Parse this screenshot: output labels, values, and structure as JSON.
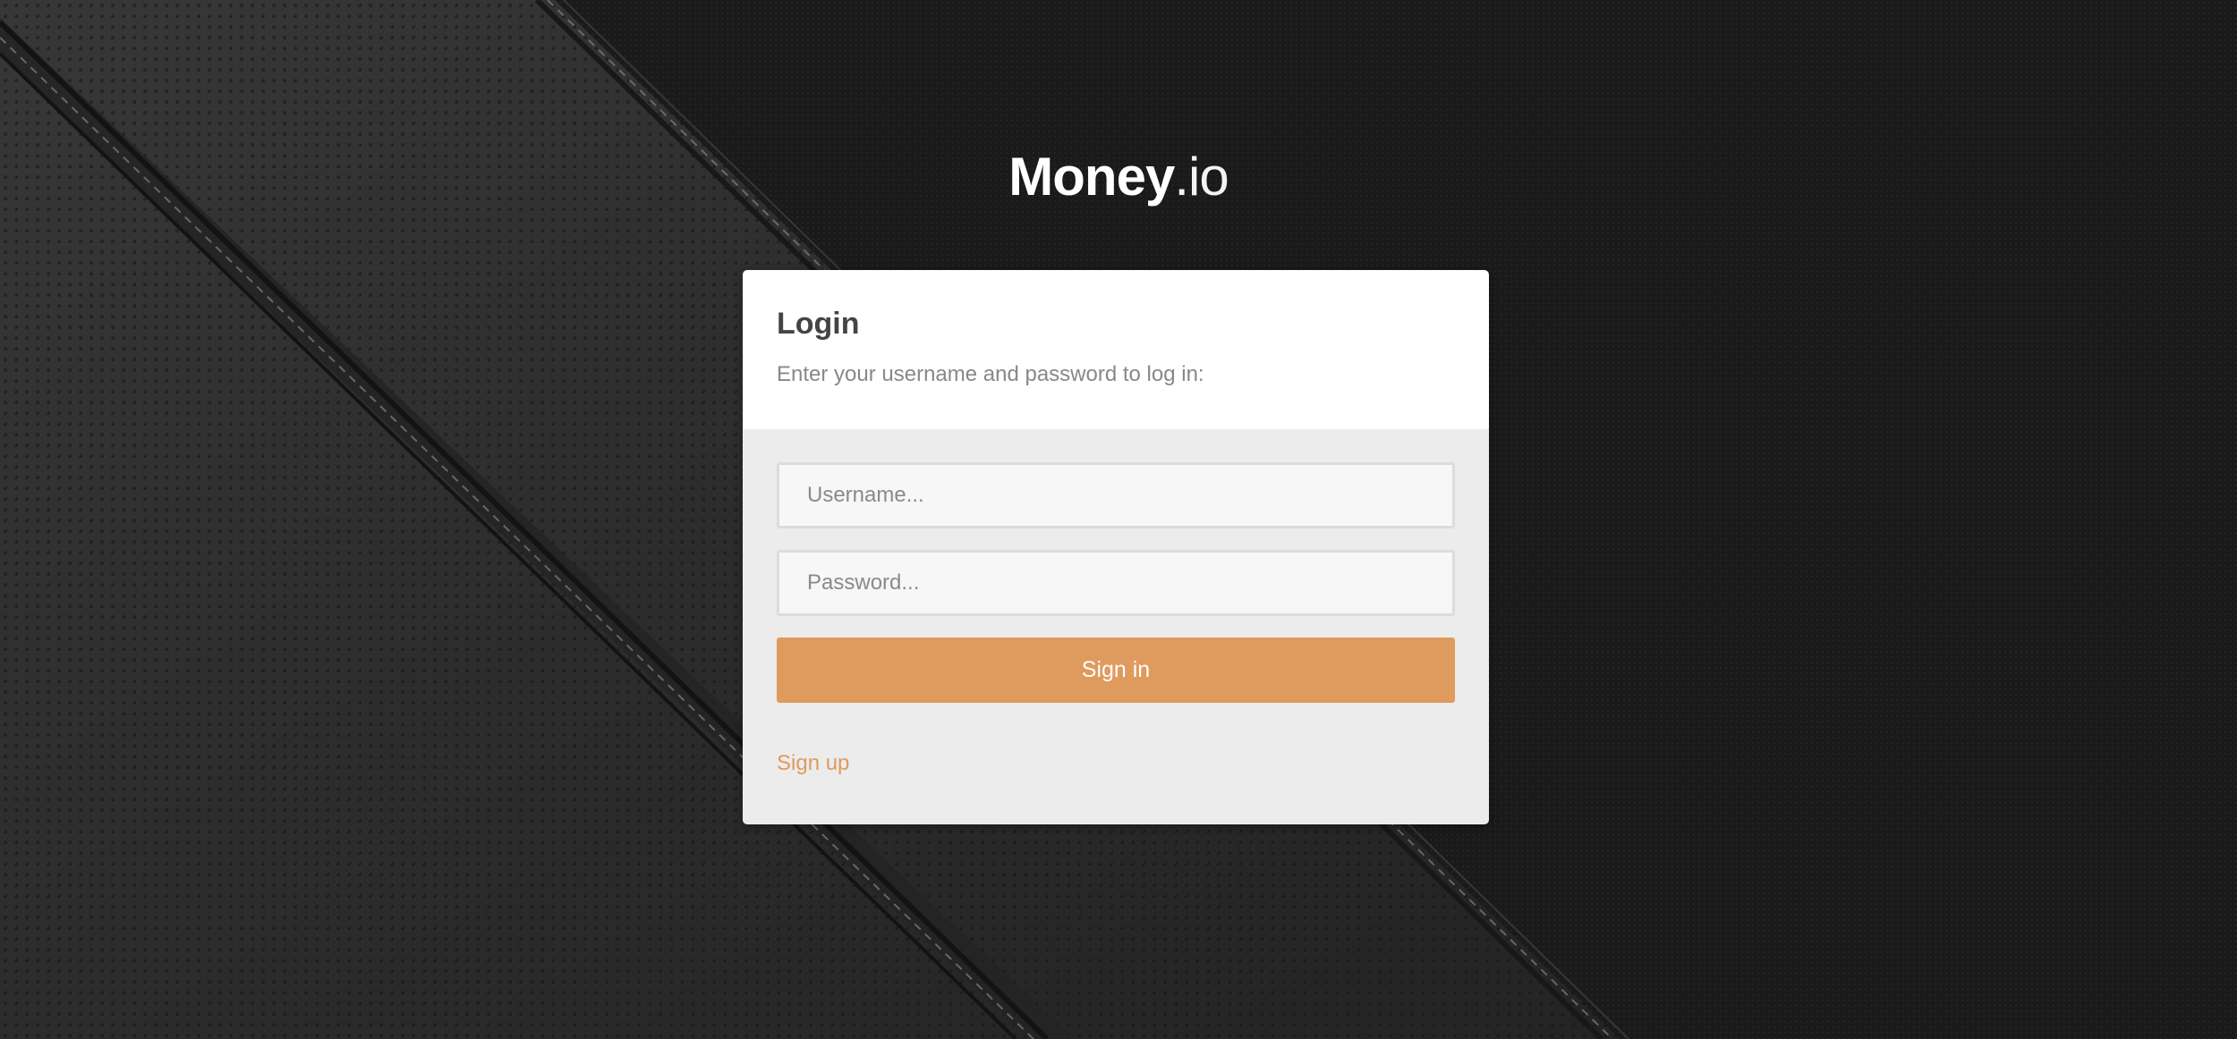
{
  "brand": {
    "name_bold": "Money",
    "name_light": ".io"
  },
  "login": {
    "title": "Login",
    "subtitle": "Enter your username and password to log in:",
    "username_placeholder": "Username...",
    "password_placeholder": "Password...",
    "signin_label": "Sign in",
    "signup_label": "Sign up"
  },
  "colors": {
    "accent": "#df9a5d",
    "background": "#1c1c1c",
    "card_header": "#ffffff",
    "card_body": "#ececec"
  }
}
